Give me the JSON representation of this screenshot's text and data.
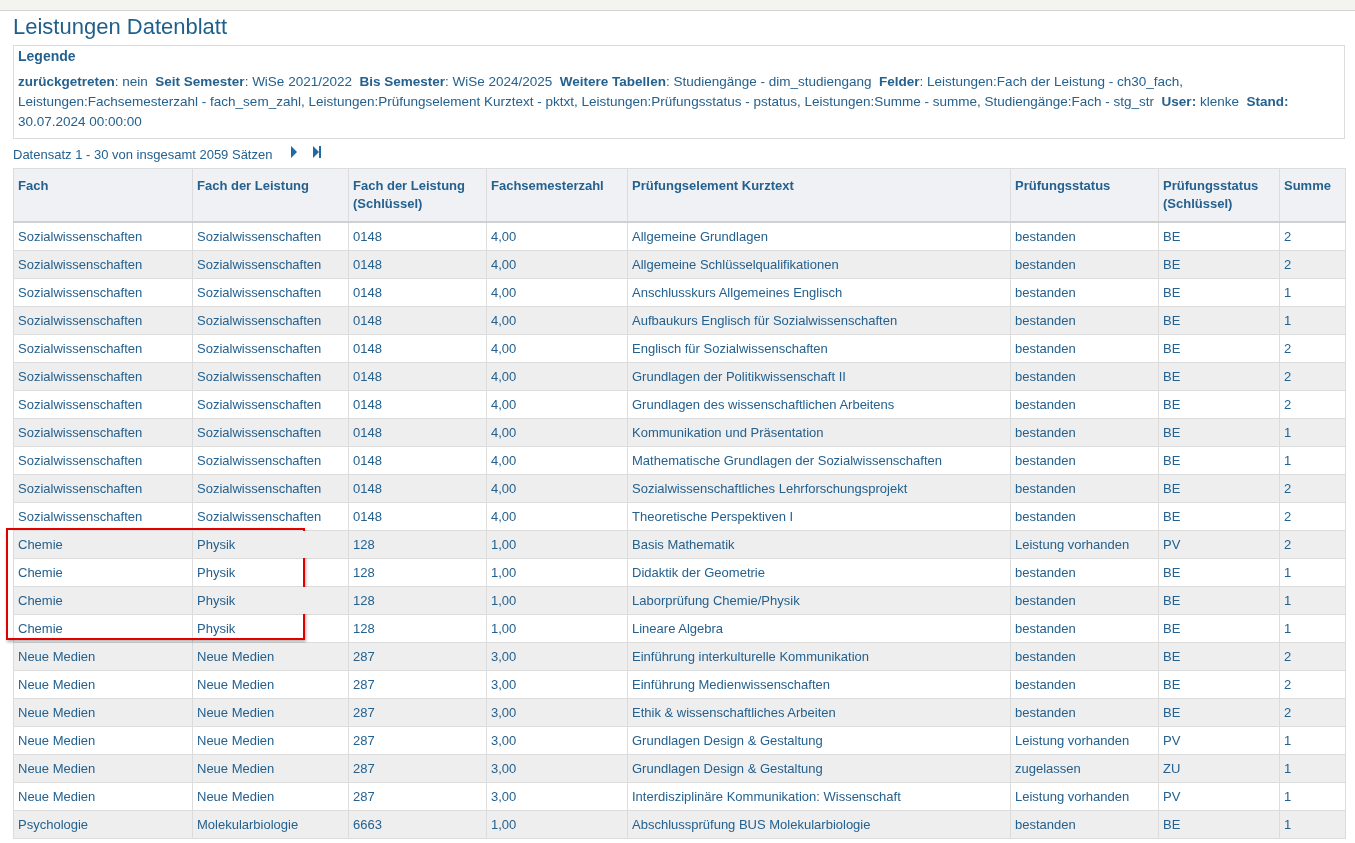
{
  "title": "Leistungen Datenblatt",
  "legend": {
    "heading": "Legende",
    "text": "**zurückgetreten**: nein  **Seit Semester**: WiSe 2021/2022  **Bis Semester**: WiSe 2024/2025  **Weitere Tabellen**: Studiengänge - dim_studiengang  **Felder**: Leistungen:Fach der Leistung - ch30_fach, Leistungen:Fachsemesterzahl - fach_sem_zahl, Leistungen:Prüfungselement Kurztext - pktxt, Leistungen:Prüfungsstatus - pstatus, Leistungen:Summe - summe, Studiengänge:Fach - stg_str  **User:** klenke  **Stand:** 30.07.2024 00:00:00"
  },
  "pager": {
    "text": "Datensatz 1 - 30 von insgesamt 2059 Sätzen"
  },
  "table": {
    "columns": [
      "Fach",
      "Fach der Leistung",
      "Fach der Leistung (Schlüssel)",
      "Fachsemesterzahl",
      "Prüfungselement Kurztext",
      "Prüfungsstatus",
      "Prüfungsstatus (Schlüssel)",
      "Summe"
    ],
    "rows": [
      {
        "cells": [
          "Sozialwissenschaften",
          "Sozialwissenschaften",
          "0148",
          "4,00",
          "Allgemeine Grundlagen",
          "bestanden",
          "BE",
          "2"
        ],
        "highlighted": false
      },
      {
        "cells": [
          "Sozialwissenschaften",
          "Sozialwissenschaften",
          "0148",
          "4,00",
          "Allgemeine Schlüsselqualifikationen",
          "bestanden",
          "BE",
          "2"
        ],
        "highlighted": false
      },
      {
        "cells": [
          "Sozialwissenschaften",
          "Sozialwissenschaften",
          "0148",
          "4,00",
          "Anschlusskurs Allgemeines Englisch",
          "bestanden",
          "BE",
          "1"
        ],
        "highlighted": false
      },
      {
        "cells": [
          "Sozialwissenschaften",
          "Sozialwissenschaften",
          "0148",
          "4,00",
          "Aufbaukurs Englisch für Sozialwissenschaften",
          "bestanden",
          "BE",
          "1"
        ],
        "highlighted": false
      },
      {
        "cells": [
          "Sozialwissenschaften",
          "Sozialwissenschaften",
          "0148",
          "4,00",
          "Englisch für Sozialwissenschaften",
          "bestanden",
          "BE",
          "2"
        ],
        "highlighted": false
      },
      {
        "cells": [
          "Sozialwissenschaften",
          "Sozialwissenschaften",
          "0148",
          "4,00",
          "Grundlagen der Politikwissenschaft II",
          "bestanden",
          "BE",
          "2"
        ],
        "highlighted": false
      },
      {
        "cells": [
          "Sozialwissenschaften",
          "Sozialwissenschaften",
          "0148",
          "4,00",
          "Grundlagen des wissenschaftlichen Arbeitens",
          "bestanden",
          "BE",
          "2"
        ],
        "highlighted": false
      },
      {
        "cells": [
          "Sozialwissenschaften",
          "Sozialwissenschaften",
          "0148",
          "4,00",
          "Kommunikation und Präsentation",
          "bestanden",
          "BE",
          "1"
        ],
        "highlighted": false
      },
      {
        "cells": [
          "Sozialwissenschaften",
          "Sozialwissenschaften",
          "0148",
          "4,00",
          "Mathematische Grundlagen der Sozialwissenschaften",
          "bestanden",
          "BE",
          "1"
        ],
        "highlighted": false
      },
      {
        "cells": [
          "Sozialwissenschaften",
          "Sozialwissenschaften",
          "0148",
          "4,00",
          "Sozialwissenschaftliches Lehrforschungsprojekt",
          "bestanden",
          "BE",
          "2"
        ],
        "highlighted": false
      },
      {
        "cells": [
          "Sozialwissenschaften",
          "Sozialwissenschaften",
          "0148",
          "4,00",
          "Theoretische Perspektiven I",
          "bestanden",
          "BE",
          "2"
        ],
        "highlighted": false
      },
      {
        "cells": [
          "Chemie",
          "Physik",
          "128",
          "1,00",
          "Basis Mathematik",
          "Leistung vorhanden",
          "PV",
          "2"
        ],
        "highlighted": true
      },
      {
        "cells": [
          "Chemie",
          "Physik",
          "128",
          "1,00",
          "Didaktik der Geometrie",
          "bestanden",
          "BE",
          "1"
        ],
        "highlighted": true
      },
      {
        "cells": [
          "Chemie",
          "Physik",
          "128",
          "1,00",
          "Laborprüfung Chemie/Physik",
          "bestanden",
          "BE",
          "1"
        ],
        "highlighted": true
      },
      {
        "cells": [
          "Chemie",
          "Physik",
          "128",
          "1,00",
          "Lineare Algebra",
          "bestanden",
          "BE",
          "1"
        ],
        "highlighted": true
      },
      {
        "cells": [
          "Neue Medien",
          "Neue Medien",
          "287",
          "3,00",
          "Einführung interkulturelle Kommunikation",
          "bestanden",
          "BE",
          "2"
        ],
        "highlighted": false
      },
      {
        "cells": [
          "Neue Medien",
          "Neue Medien",
          "287",
          "3,00",
          "Einführung Medienwissenschaften",
          "bestanden",
          "BE",
          "2"
        ],
        "highlighted": false
      },
      {
        "cells": [
          "Neue Medien",
          "Neue Medien",
          "287",
          "3,00",
          "Ethik & wissenschaftliches Arbeiten",
          "bestanden",
          "BE",
          "2"
        ],
        "highlighted": false
      },
      {
        "cells": [
          "Neue Medien",
          "Neue Medien",
          "287",
          "3,00",
          "Grundlagen Design & Gestaltung",
          "Leistung vorhanden",
          "PV",
          "1"
        ],
        "highlighted": false
      },
      {
        "cells": [
          "Neue Medien",
          "Neue Medien",
          "287",
          "3,00",
          "Grundlagen Design & Gestaltung",
          "zugelassen",
          "ZU",
          "1"
        ],
        "highlighted": false
      },
      {
        "cells": [
          "Neue Medien",
          "Neue Medien",
          "287",
          "3,00",
          "Interdisziplinäre Kommunikation: Wissenschaft",
          "Leistung vorhanden",
          "PV",
          "1"
        ],
        "highlighted": false
      },
      {
        "cells": [
          "Psychologie",
          "Molekularbiologie",
          "6663",
          "1,00",
          "Abschlussprüfung BUS Molekularbiologie",
          "bestanden",
          "BE",
          "1"
        ],
        "highlighted": false
      }
    ]
  }
}
